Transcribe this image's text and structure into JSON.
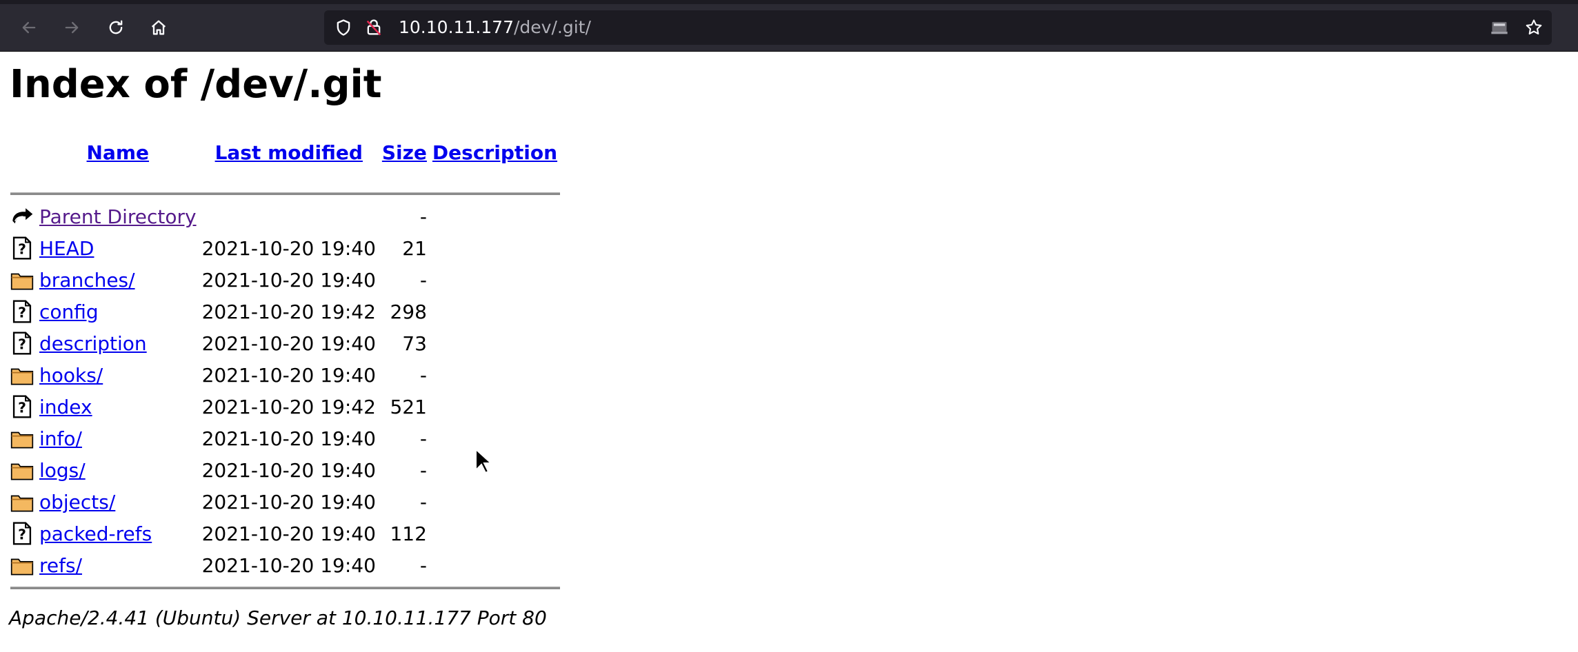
{
  "browser": {
    "url_host": "10.10.11.177",
    "url_path": "/dev/.git/"
  },
  "page": {
    "title": "Index of /dev/.git",
    "columns": {
      "name": "Name",
      "last_modified": "Last modified",
      "size": "Size",
      "description": "Description"
    },
    "entries": [
      {
        "icon": "parent-dir-icon",
        "name": "Parent Directory",
        "modified": "",
        "size": "-"
      },
      {
        "icon": "unknown-file-icon",
        "name": "HEAD",
        "modified": "2021-10-20 19:40",
        "size": "21"
      },
      {
        "icon": "folder-icon",
        "name": "branches/",
        "modified": "2021-10-20 19:40",
        "size": "-"
      },
      {
        "icon": "unknown-file-icon",
        "name": "config",
        "modified": "2021-10-20 19:42",
        "size": "298"
      },
      {
        "icon": "unknown-file-icon",
        "name": "description",
        "modified": "2021-10-20 19:40",
        "size": "73"
      },
      {
        "icon": "folder-icon",
        "name": "hooks/",
        "modified": "2021-10-20 19:40",
        "size": "-"
      },
      {
        "icon": "unknown-file-icon",
        "name": "index",
        "modified": "2021-10-20 19:42",
        "size": "521"
      },
      {
        "icon": "folder-icon",
        "name": "info/",
        "modified": "2021-10-20 19:40",
        "size": "-"
      },
      {
        "icon": "folder-icon",
        "name": "logs/",
        "modified": "2021-10-20 19:40",
        "size": "-"
      },
      {
        "icon": "folder-icon",
        "name": "objects/",
        "modified": "2021-10-20 19:40",
        "size": "-"
      },
      {
        "icon": "unknown-file-icon",
        "name": "packed-refs",
        "modified": "2021-10-20 19:40",
        "size": "112"
      },
      {
        "icon": "folder-icon",
        "name": "refs/",
        "modified": "2021-10-20 19:40",
        "size": "-"
      }
    ],
    "footer": "Apache/2.4.41 (Ubuntu) Server at 10.10.11.177 Port 80"
  },
  "colors": {
    "link": "#0000ee",
    "visited_link": "#551a8b",
    "toolbar": "#2b2a33",
    "urlbar": "#1c1b22"
  }
}
